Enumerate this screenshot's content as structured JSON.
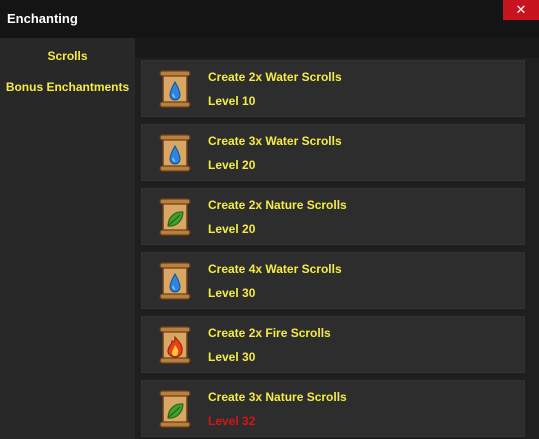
{
  "window": {
    "title": "Enchanting",
    "close_label": "✕"
  },
  "colors": {
    "level_ok": "#f5ec43",
    "level_locked": "#d61616",
    "accent_yellow": "#f5ec43",
    "close_red": "#c8141e"
  },
  "sidebar": {
    "items": [
      {
        "label": "Scrolls"
      },
      {
        "label": "Bonus Enchantments"
      }
    ]
  },
  "recipes": [
    {
      "name": "Create 2x Water Scrolls",
      "level": "Level 10",
      "icon": "water-scroll-icon",
      "locked": false
    },
    {
      "name": "Create 3x Water Scrolls",
      "level": "Level 20",
      "icon": "water-scroll-icon",
      "locked": false
    },
    {
      "name": "Create 2x Nature Scrolls",
      "level": "Level 20",
      "icon": "nature-scroll-icon",
      "locked": false
    },
    {
      "name": "Create 4x Water Scrolls",
      "level": "Level 30",
      "icon": "water-scroll-icon",
      "locked": false
    },
    {
      "name": "Create 2x Fire Scrolls",
      "level": "Level 30",
      "icon": "fire-scroll-icon",
      "locked": false
    },
    {
      "name": "Create 3x Nature Scrolls",
      "level": "Level 32",
      "icon": "nature-scroll-icon",
      "locked": true
    }
  ]
}
